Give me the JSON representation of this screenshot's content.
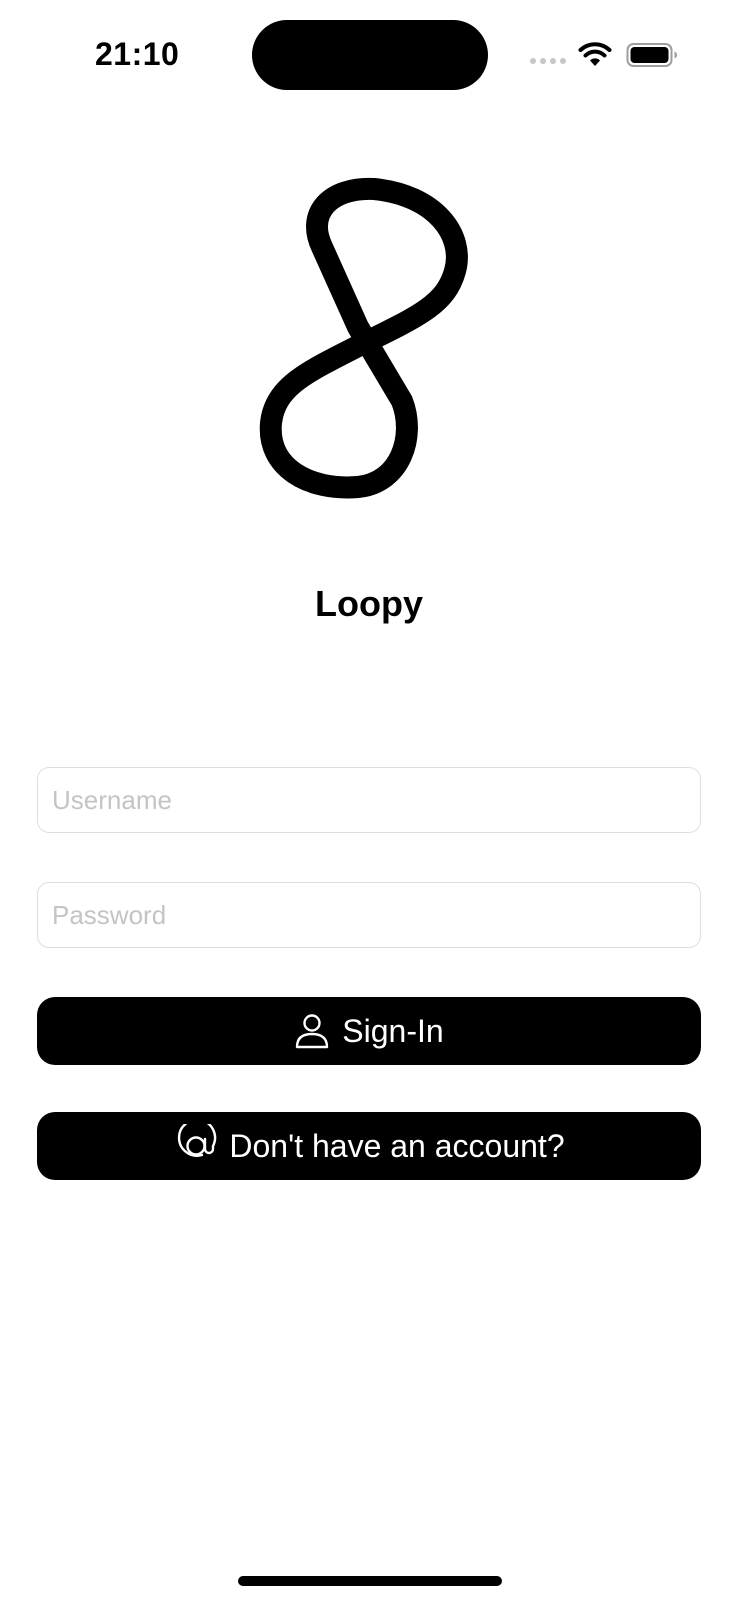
{
  "status_bar": {
    "time": "21:10",
    "icons": [
      "cellular-signal-icon",
      "wifi-icon",
      "battery-icon"
    ]
  },
  "logo": {
    "icon": "infinity-loop-logo-icon"
  },
  "app": {
    "title": "Loopy"
  },
  "form": {
    "username": {
      "placeholder": "Username",
      "value": ""
    },
    "password": {
      "placeholder": "Password",
      "value": ""
    }
  },
  "buttons": {
    "sign_in": {
      "label": "Sign-In",
      "icon": "person-icon"
    },
    "sign_up": {
      "label": "Don't have an account?",
      "icon": "at-sign-icon"
    }
  },
  "colors": {
    "background": "#ffffff",
    "primary": "#000000",
    "button_text": "#ffffff",
    "placeholder": "#c4c4c4",
    "input_border": "#dedede"
  }
}
